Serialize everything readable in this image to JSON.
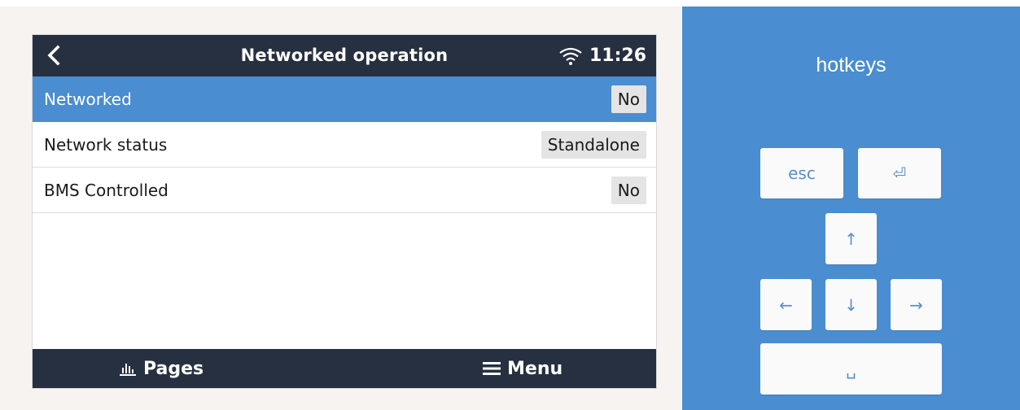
{
  "screen": {
    "title": "Networked operation",
    "clock": "11:26",
    "rows": [
      {
        "label": "Networked",
        "value": "No",
        "selected": true
      },
      {
        "label": "Network status",
        "value": "Standalone",
        "selected": false
      },
      {
        "label": "BMS Controlled",
        "value": "No",
        "selected": false
      }
    ],
    "bottom": {
      "pages_label": "Pages",
      "menu_label": "Menu"
    }
  },
  "hotkeys": {
    "title": "hotkeys",
    "esc_label": "esc",
    "enter_symbol": "⏎",
    "up_symbol": "↑",
    "left_symbol": "←",
    "down_symbol": "↓",
    "right_symbol": "→",
    "space_symbol": "␣"
  },
  "colors": {
    "titlebar": "#263040",
    "accent": "#4a8dd0",
    "value_bg": "#e4e4e4",
    "key_text": "#5a8fcb"
  }
}
